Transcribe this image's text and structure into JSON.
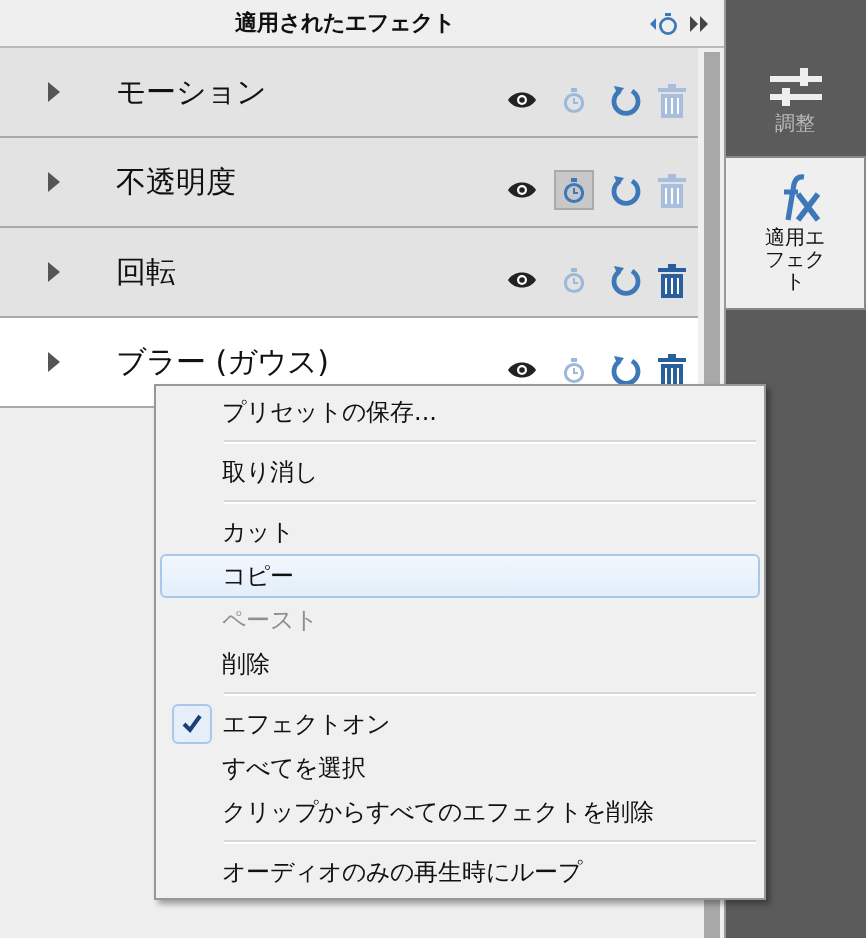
{
  "panel": {
    "title": "適用されたエフェクト"
  },
  "effects": [
    {
      "name": "モーション",
      "selected": false,
      "animated": false,
      "deletable": false
    },
    {
      "name": "不透明度",
      "selected": false,
      "animated": true,
      "deletable": false
    },
    {
      "name": "回転",
      "selected": false,
      "animated": false,
      "deletable": true
    },
    {
      "name": "ブラー (ガウス)",
      "selected": true,
      "animated": false,
      "deletable": true
    }
  ],
  "sidebar": {
    "tabs": [
      {
        "label": "調整",
        "kind": "adjust",
        "selected": false
      },
      {
        "label": "適用エフェクト",
        "kind": "effects",
        "selected": true
      }
    ]
  },
  "context_menu": {
    "items": [
      {
        "kind": "item",
        "label": "プリセットの保存...",
        "highlighted": false,
        "disabled": false,
        "checked": false
      },
      {
        "kind": "separator"
      },
      {
        "kind": "item",
        "label": "取り消し",
        "highlighted": false,
        "disabled": false,
        "checked": false
      },
      {
        "kind": "separator"
      },
      {
        "kind": "item",
        "label": "カット",
        "highlighted": false,
        "disabled": false,
        "checked": false
      },
      {
        "kind": "item",
        "label": "コピー",
        "highlighted": true,
        "disabled": false,
        "checked": false
      },
      {
        "kind": "item",
        "label": "ペースト",
        "highlighted": false,
        "disabled": true,
        "checked": false
      },
      {
        "kind": "item",
        "label": "削除",
        "highlighted": false,
        "disabled": false,
        "checked": false
      },
      {
        "kind": "separator"
      },
      {
        "kind": "item",
        "label": "エフェクトオン",
        "highlighted": false,
        "disabled": false,
        "checked": true
      },
      {
        "kind": "item",
        "label": "すべてを選択",
        "highlighted": false,
        "disabled": false,
        "checked": false
      },
      {
        "kind": "item",
        "label": "クリップからすべてのエフェクトを削除",
        "highlighted": false,
        "disabled": false,
        "checked": false
      },
      {
        "kind": "separator"
      },
      {
        "kind": "item",
        "label": "オーディオのみの再生時にループ",
        "highlighted": false,
        "disabled": false,
        "checked": false
      }
    ]
  }
}
